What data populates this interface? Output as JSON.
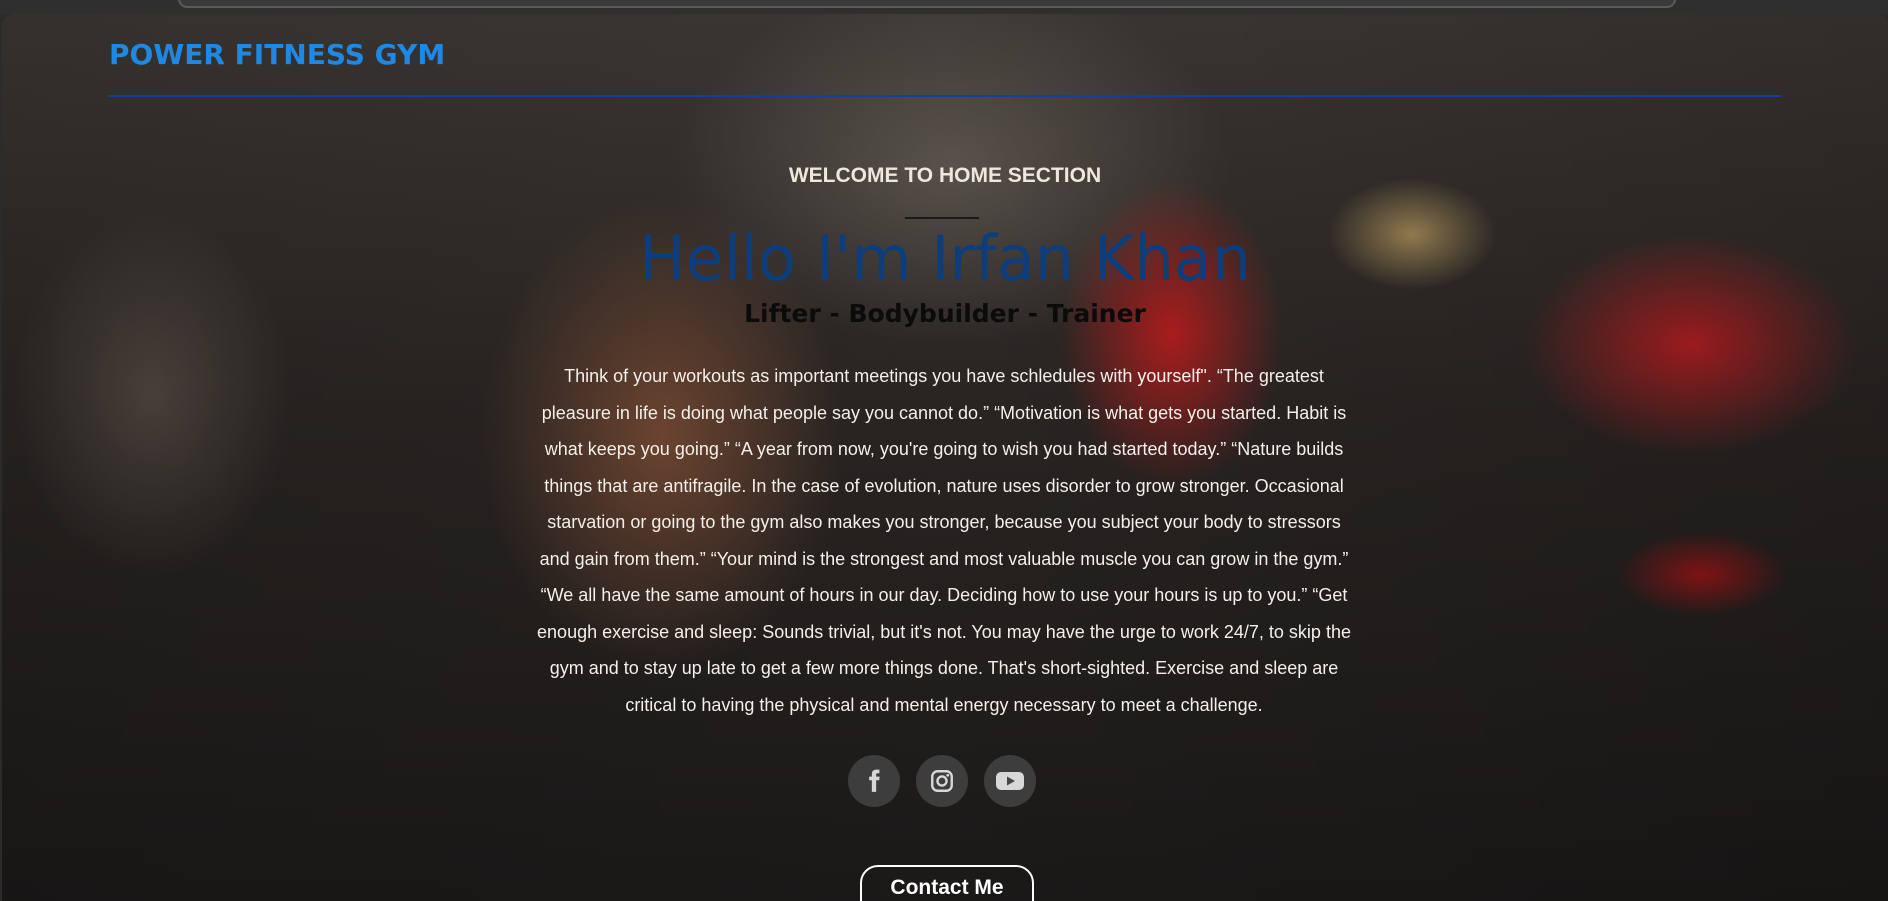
{
  "header": {
    "brand": "POWER FITNESS GYM"
  },
  "hero": {
    "eyebrow": "WELCOME TO HOME SECTION",
    "headline": "Hello I'm Irfan Khan",
    "roles": "Lifter - Bodybuilder - Trainer",
    "quote": "Think of your workouts as important meetings you have schledules with yourself\". “The greatest pleasure in life is doing what people say you cannot do.” “Motivation is what gets you started. Habit is what keeps you going.” “A year from now, you're going to wish you had started today.” “Nature builds things that are antifragile. In the case of evolution, nature uses disorder to grow stronger. Occasional starvation or going to the gym also makes you stronger, because you subject your body to stressors and gain from them.” “Your mind is the strongest and most valuable muscle you can grow in the gym.” “We all have the same amount of hours in our day. Deciding how to use your hours is up to you.” “Get enough exercise and sleep: Sounds trivial, but it's not. You may have the urge to work 24/7, to skip the gym and to stay up late to get a few more things done. That's short-sighted. Exercise and sleep are critical to having the physical and mental energy necessary to meet a challenge.",
    "socials": [
      {
        "icon": "facebook-icon"
      },
      {
        "icon": "instagram-icon"
      },
      {
        "icon": "youtube-icon"
      }
    ],
    "contact_label": "Contact Me"
  },
  "colors": {
    "brand": "#1e88e5",
    "headline": "#0d3d7a",
    "rule": "#1340a0"
  }
}
